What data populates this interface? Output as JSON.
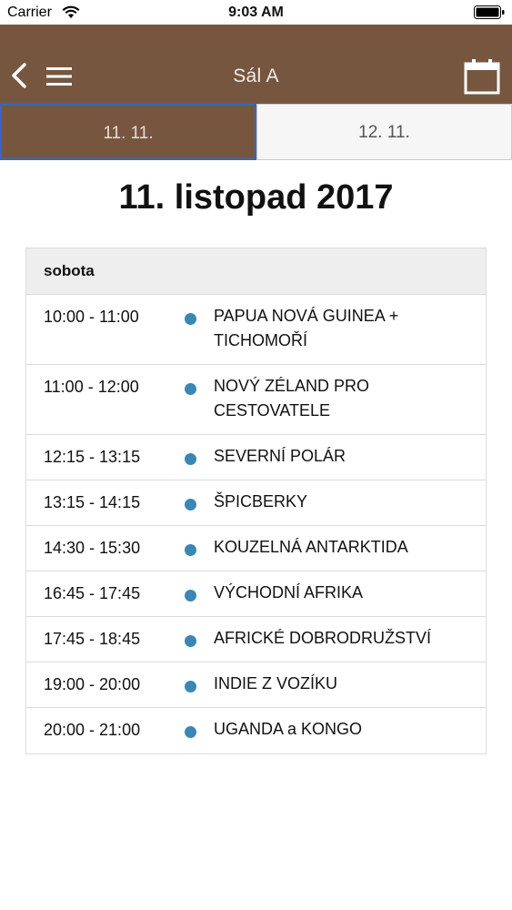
{
  "status_bar": {
    "carrier": "Carrier",
    "time": "9:03 AM"
  },
  "nav": {
    "title": "Sál A"
  },
  "tabs": [
    {
      "label": "11. 11.",
      "active": true
    },
    {
      "label": "12. 11.",
      "active": false
    }
  ],
  "day_title": "11. listopad 2017",
  "schedule": {
    "header": "sobota",
    "items": [
      {
        "time": "10:00 - 11:00",
        "title": "PAPUA NOVÁ GUINEA + TICHOMOŘÍ"
      },
      {
        "time": "11:00 - 12:00",
        "title": "NOVÝ ZÉLAND PRO CESTOVATELE"
      },
      {
        "time": "12:15 - 13:15",
        "title": "SEVERNÍ POLÁR"
      },
      {
        "time": "13:15 - 14:15",
        "title": "ŠPICBERKY"
      },
      {
        "time": "14:30 - 15:30",
        "title": "KOUZELNÁ ANTARKTIDA"
      },
      {
        "time": "16:45 - 17:45",
        "title": "VÝCHODNÍ AFRIKA"
      },
      {
        "time": "17:45 - 18:45",
        "title": "AFRICKÉ DOBRODRUŽSTVÍ"
      },
      {
        "time": "19:00 - 20:00",
        "title": "INDIE Z VOZÍKU"
      },
      {
        "time": "20:00 - 21:00",
        "title": "UGANDA a KONGO"
      }
    ]
  },
  "colors": {
    "nav_bg": "#775640",
    "dot": "#3b87b4",
    "active_tab_border": "#3a64c8"
  },
  "icons": {
    "back": "chevron-left-icon",
    "menu": "hamburger-menu-icon",
    "calendar": "calendar-icon",
    "wifi": "wifi-icon",
    "battery": "battery-icon"
  }
}
